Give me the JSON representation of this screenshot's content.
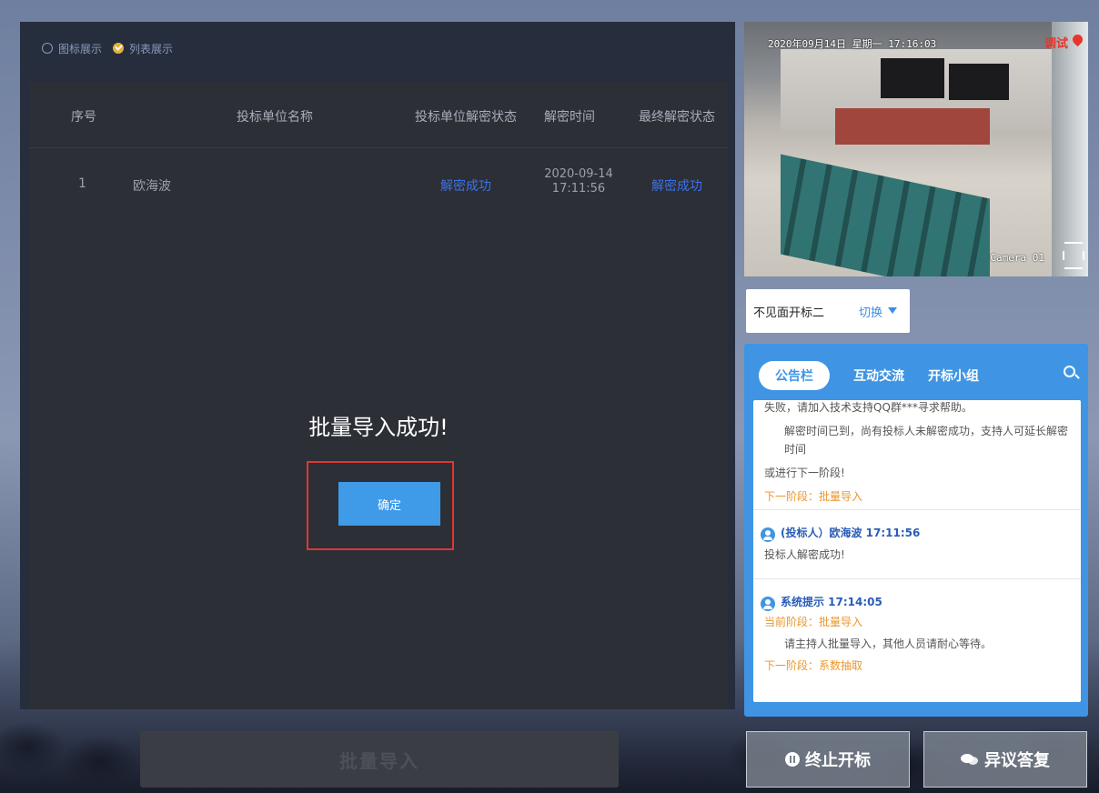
{
  "view_toggle": {
    "icon_view_label": "图标展示",
    "list_view_label": "列表展示"
  },
  "table": {
    "headers": [
      "序号",
      "投标单位名称",
      "投标单位解密状态",
      "解密时间",
      "最终解密状态"
    ],
    "rows": [
      {
        "index": "1",
        "bidder": "欧海波",
        "decrypt_status": "解密成功",
        "decrypt_date": "2020-09-14",
        "decrypt_time": "17:11:56",
        "final_status": "解密成功"
      }
    ]
  },
  "dialog": {
    "message": "批量导入成功!",
    "confirm_label": "确定"
  },
  "bottom_left": {
    "batch_import_label": "批量导入"
  },
  "camera": {
    "datetime": "2020年09月14日 星期一 17:16:03",
    "status": "调试",
    "label": "Camera 01"
  },
  "room_select": {
    "room_name": "不见面开标二",
    "switch_label": "切换"
  },
  "notice": {
    "tabs": [
      "公告栏",
      "互动交流",
      "开标小组"
    ],
    "active_tab": 0,
    "block1": {
      "line1": "失败，请加入技术支持QQ群***寻求帮助。",
      "line2": "解密时间已到，尚有投标人未解密成功，支持人可延长解密时间",
      "line3": "或进行下一阶段!",
      "next_stage": "下一阶段：批量导入"
    },
    "msg1": {
      "sender": "(投标人）欧海波 17:11:56",
      "text": "投标人解密成功!"
    },
    "msg2": {
      "sender": "系统提示 17:14:05",
      "current_stage": "当前阶段：批量导入",
      "text": "请主持人批量导入，其他人员请耐心等待。",
      "next_stage": "下一阶段：系数抽取"
    }
  },
  "actions": {
    "stop_label": "终止开标",
    "objection_label": "异议答复"
  },
  "colors": {
    "accent_blue": "#3f95e3",
    "success_blue": "#3a73e8",
    "highlight_red": "#e03535",
    "stage_orange": "#e8962e"
  }
}
